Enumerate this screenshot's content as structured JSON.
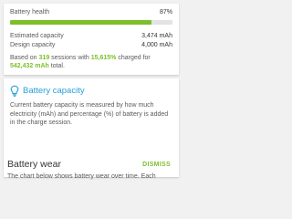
{
  "health": {
    "label": "Battery health",
    "value": "87%",
    "progress_percent": 87,
    "estimated_label": "Estimated capacity",
    "estimated_value": "3,474 mAh",
    "design_label": "Design capacity",
    "design_value": "4,000 mAh",
    "sessions_prefix": "Based on ",
    "sessions_count": "319",
    "sessions_middle": " sessions with ",
    "sessions_percent": "15,615%",
    "sessions_suffix": " charged for",
    "sessions_total": "542,432 mAh",
    "sessions_end": " total."
  },
  "info_card": {
    "icon": "lightbulb-icon",
    "title": "Battery capacity",
    "body": "Current battery capacity is measured by how much electricity (mAh) and percentage (%) of battery is added in the charge session.",
    "dismiss_label": "DISMISS"
  },
  "wear_section": {
    "title": "Battery wear",
    "body": "The chart below shows battery wear over time. Each"
  },
  "colors": {
    "accent_green": "#7cbf2a",
    "accent_blue": "#2a9fd8",
    "progress_track": "#e3e3e3"
  }
}
